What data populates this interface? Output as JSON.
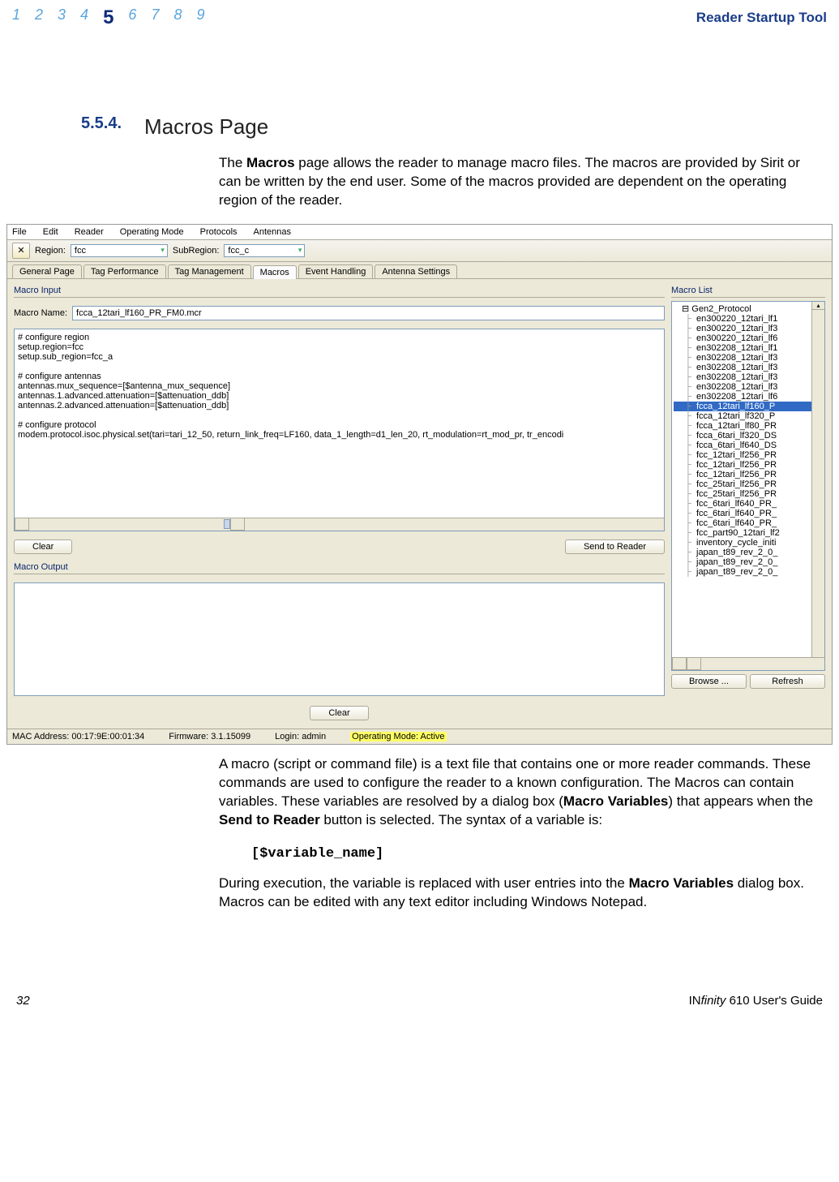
{
  "header": {
    "sections": [
      "1",
      "2",
      "3",
      "4",
      "5",
      "6",
      "7",
      "8",
      "9"
    ],
    "current": "5",
    "title": "Reader Startup Tool"
  },
  "section": {
    "num": "5.5.4.",
    "title": "Macros Page"
  },
  "intro": "The Macros page allows the reader to manage macro files. The macros are provided by Sirit or can be written by the end user. Some of the macros provided are dependent on the operating region of the reader.",
  "app": {
    "menubar": [
      "File",
      "Edit",
      "Reader",
      "Operating Mode",
      "Protocols",
      "Antennas"
    ],
    "toolbar": {
      "region_label": "Region:",
      "region_value": "fcc",
      "subregion_label": "SubRegion:",
      "subregion_value": "fcc_c"
    },
    "tabs": [
      "General Page",
      "Tag Performance",
      "Tag Management",
      "Macros",
      "Event Handling",
      "Antenna Settings"
    ],
    "active_tab": "Macros",
    "macro_input_label": "Macro Input",
    "macro_name_label": "Macro Name:",
    "macro_name_value": "fcca_12tari_lf160_PR_FM0.mcr",
    "macro_text": "# configure region\nsetup.region=fcc\nsetup.sub_region=fcc_a\n\n# configure antennas\nantennas.mux_sequence=[$antenna_mux_sequence]\nantennas.1.advanced.attenuation=[$attenuation_ddb]\nantennas.2.advanced.attenuation=[$attenuation_ddb]\n\n# configure protocol\nmodem.protocol.isoc.physical.set(tari=tari_12_50, return_link_freq=LF160, data_1_length=d1_len_20, rt_modulation=rt_mod_pr, tr_encodi",
    "clear_btn": "Clear",
    "send_btn": "Send to Reader",
    "macro_output_label": "Macro Output",
    "clear2_btn": "Clear",
    "macro_list_label": "Macro List",
    "tree_root": "Gen2_Protocol",
    "tree_items": [
      "en300220_12tari_lf1",
      "en300220_12tari_lf3",
      "en300220_12tari_lf6",
      "en302208_12tari_lf1",
      "en302208_12tari_lf3",
      "en302208_12tari_lf3",
      "en302208_12tari_lf3",
      "en302208_12tari_lf3",
      "en302208_12tari_lf6",
      "fcca_12tari_lf160_P",
      "fcca_12tari_lf320_P",
      "fcca_12tari_lf80_PR",
      "fcca_6tari_lf320_DS",
      "fcca_6tari_lf640_DS",
      "fcc_12tari_lf256_PR",
      "fcc_12tari_lf256_PR",
      "fcc_12tari_lf256_PR",
      "fcc_25tari_lf256_PR",
      "fcc_25tari_lf256_PR",
      "fcc_6tari_lf640_PR_",
      "fcc_6tari_lf640_PR_",
      "fcc_6tari_lf640_PR_",
      "fcc_part90_12tari_lf2",
      "inventory_cycle_initi",
      "japan_t89_rev_2_0_",
      "japan_t89_rev_2_0_",
      "japan_t89_rev_2_0_"
    ],
    "tree_selected_index": 9,
    "browse_btn": "Browse ...",
    "refresh_btn": "Refresh",
    "status": {
      "mac_label": "MAC Address: 00:17:9E:00:01:34",
      "fw_label": "Firmware: 3.1.15099",
      "login_label": "Login: admin",
      "opmode_label": "Operating Mode: Active"
    }
  },
  "para2a": "A macro (script or command file) is a text file that contains one or more reader commands. These commands are used to configure the reader to a known configuration. The Macros can contain variables. These variables are resolved by a dialog box (",
  "para2b": "Macro Variables",
  "para2c": ") that appears when the ",
  "para2d": "Send to Reader",
  "para2e": " button is selected. The syntax of a variable is:",
  "codevar": "[$variable_name]",
  "para3a": "During execution, the variable is replaced with user entries into the ",
  "para3b": "Macro Variables",
  "para3c": " dialog box. Macros can be edited with any text editor including Windows Notepad.",
  "footer": {
    "page": "32",
    "guide_prefix": "IN",
    "guide_mid": "finity",
    "guide_suffix": " 610 User's Guide"
  }
}
